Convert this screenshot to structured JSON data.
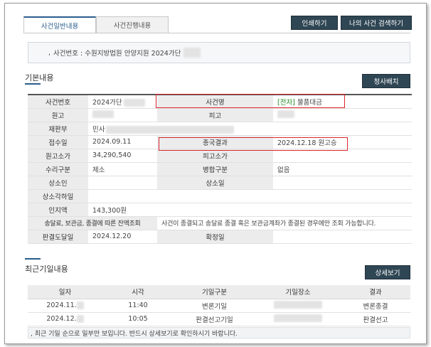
{
  "tabs": [
    {
      "label": "사건일반내용",
      "active": true
    },
    {
      "label": "사건진행내용",
      "active": false
    }
  ],
  "buttons": {
    "print": "인쇄하기",
    "my_case_search": "나의 사건 검색하기",
    "cheongsa": "청사배치",
    "detail": "상세보기"
  },
  "case_header": {
    "bullet": ",",
    "text": "사건번호 : 수원지방법원 안양지원 2024가단"
  },
  "basic": {
    "title": "기본내용",
    "rows": [
      {
        "l1": "사건번호",
        "v1": "2024가단",
        "l2": "사건명",
        "v2_prefix": "[전자]",
        "v2": "물품대금"
      },
      {
        "l1": "원고",
        "v1": "",
        "l2": "피고",
        "v2": ""
      },
      {
        "l1": "재판부",
        "v1": "민사",
        "l2": "",
        "v2": ""
      },
      {
        "l1": "접수일",
        "v1": "2024.09.11",
        "l2": "종국결과",
        "v2": "2024.12.18 원고승"
      },
      {
        "l1": "원고소가",
        "v1": "34,290,540",
        "l2": "피고소가",
        "v2": ""
      },
      {
        "l1": "수리구분",
        "v1": "제소",
        "l2": "병합구분",
        "v2": "없음"
      },
      {
        "l1": "상소인",
        "v1": "",
        "l2": "상소일",
        "v2": ""
      },
      {
        "l1": "상소각하일",
        "v1": ""
      },
      {
        "l1": "인지액",
        "v1": "143,300원"
      },
      {
        "l1": "송달료, 보관금, 종결에 따른 잔액조회",
        "v1": "사건이 종결되고 송달료 종결 혹은 보관금계좌가 종결된 경우에만 조회 가능합니다."
      },
      {
        "l1": "판결도달일",
        "v1": "2024.12.20",
        "l2": "확정일",
        "v2": ""
      }
    ]
  },
  "recent": {
    "title": "최근기일내용",
    "headers": [
      "일자",
      "시각",
      "기일구분",
      "기일장소",
      "결과"
    ],
    "rows": [
      {
        "date": "2024.11.",
        "time": "11:40",
        "type": "변론기일",
        "place": "",
        "result": "변론종결"
      },
      {
        "date": "2024.12.",
        "time": "10:05",
        "type": "판결선고기일",
        "place": "",
        "result": "판결선고"
      }
    ],
    "note": ", 최근 기일 순으로 일부만 보입니다. 반드시 상세보기로 확인하시기 바랍니다."
  }
}
